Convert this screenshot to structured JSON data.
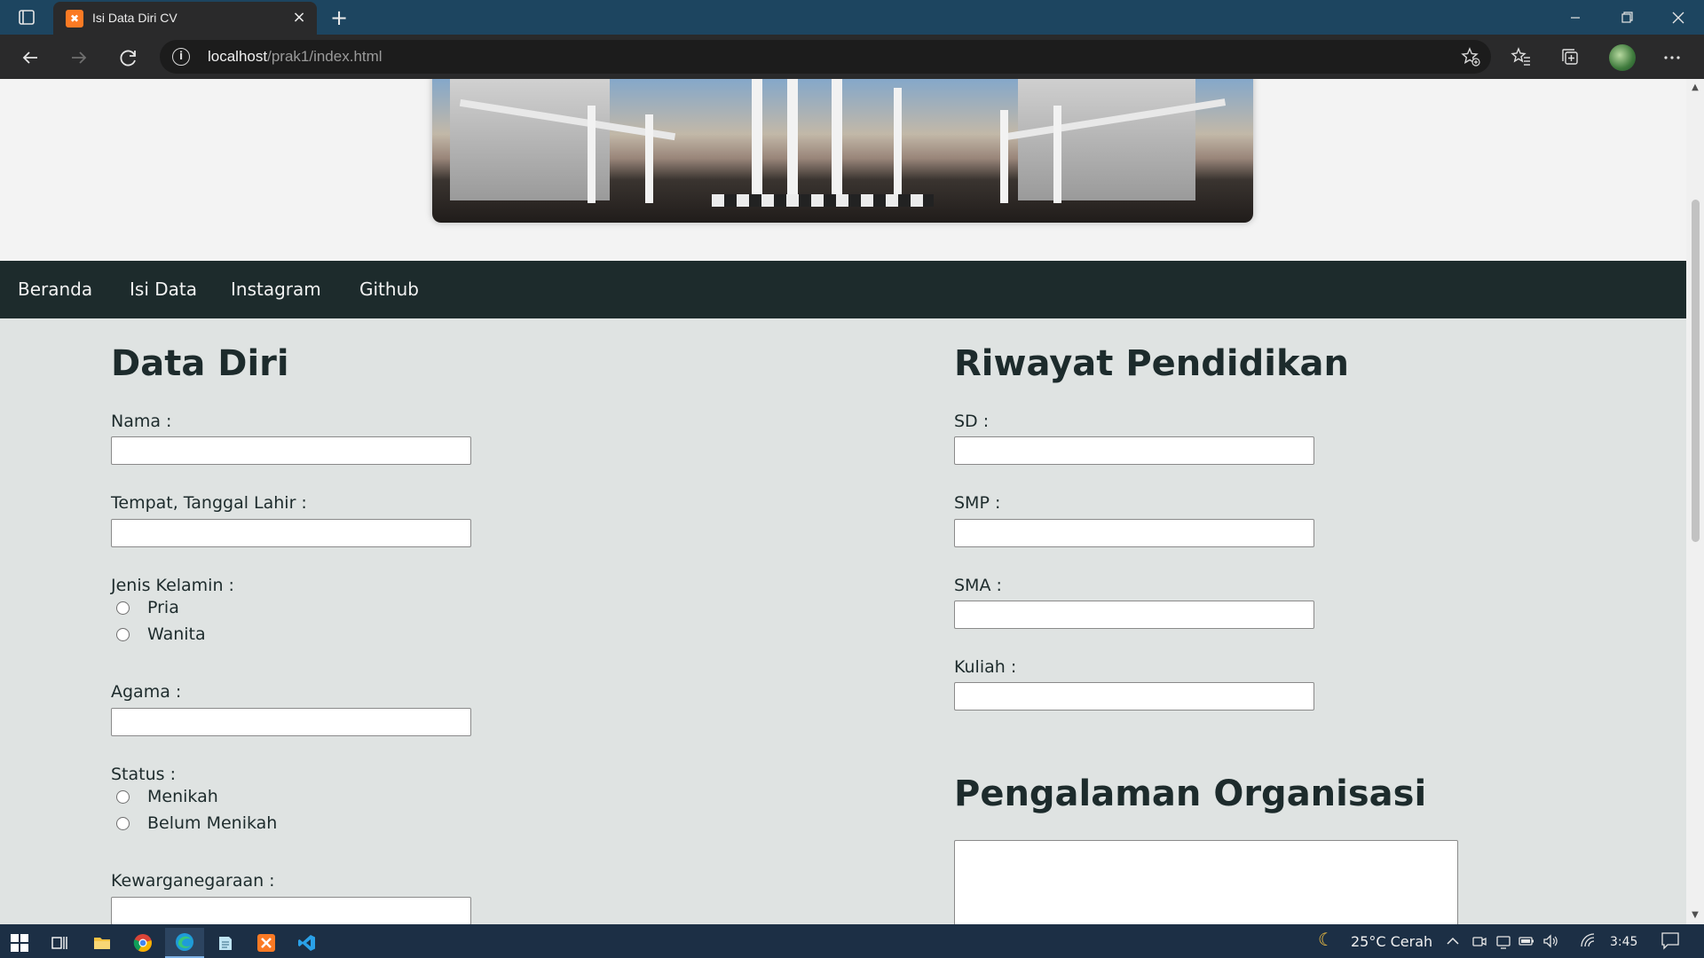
{
  "browser": {
    "tab_title": "Isi Data Diri CV",
    "tab_favicon_text": "✖",
    "url_host": "localhost",
    "url_path": "/prak1/index.html",
    "new_tab_symbol": "+",
    "close_symbol": "×",
    "icons": {
      "tab_actions": "tab-actions-icon",
      "back": "back-arrow-icon",
      "forward": "forward-arrow-icon",
      "refresh": "refresh-icon",
      "site_info": "info-icon",
      "add_favorite": "star-plus-icon",
      "favorites": "favorites-icon",
      "collections": "collections-icon",
      "profile": "profile-avatar",
      "menu": "more-icon",
      "minimize": "minimize-icon",
      "restore": "restore-icon",
      "close": "close-icon"
    }
  },
  "navbar": {
    "items": [
      "Beranda",
      "Isi Data",
      "Instagram",
      "Github"
    ]
  },
  "data_diri": {
    "title": "Data Diri",
    "nama_label": "Nama :",
    "ttl_label": "Tempat, Tanggal Lahir :",
    "jk_label": "Jenis Kelamin :",
    "jk_options": [
      "Pria",
      "Wanita"
    ],
    "agama_label": "Agama :",
    "status_label": "Status :",
    "status_options": [
      "Menikah",
      "Belum Menikah"
    ],
    "kewarganegaraan_label": "Kewarganegaraan :"
  },
  "riwayat_pendidikan": {
    "title": "Riwayat Pendidikan",
    "sd_label": "SD :",
    "smp_label": "SMP :",
    "sma_label": "SMA :",
    "kuliah_label": "Kuliah :"
  },
  "pengalaman_organisasi": {
    "title": "Pengalaman Organisasi"
  },
  "taskbar": {
    "weather": "25°C Cerah",
    "time": "3:45",
    "apps": [
      "windows-start-icon",
      "task-view-icon",
      "file-explorer-icon",
      "chrome-icon",
      "edge-icon",
      "notepad-icon",
      "xampp-icon",
      "vscode-icon"
    ]
  }
}
